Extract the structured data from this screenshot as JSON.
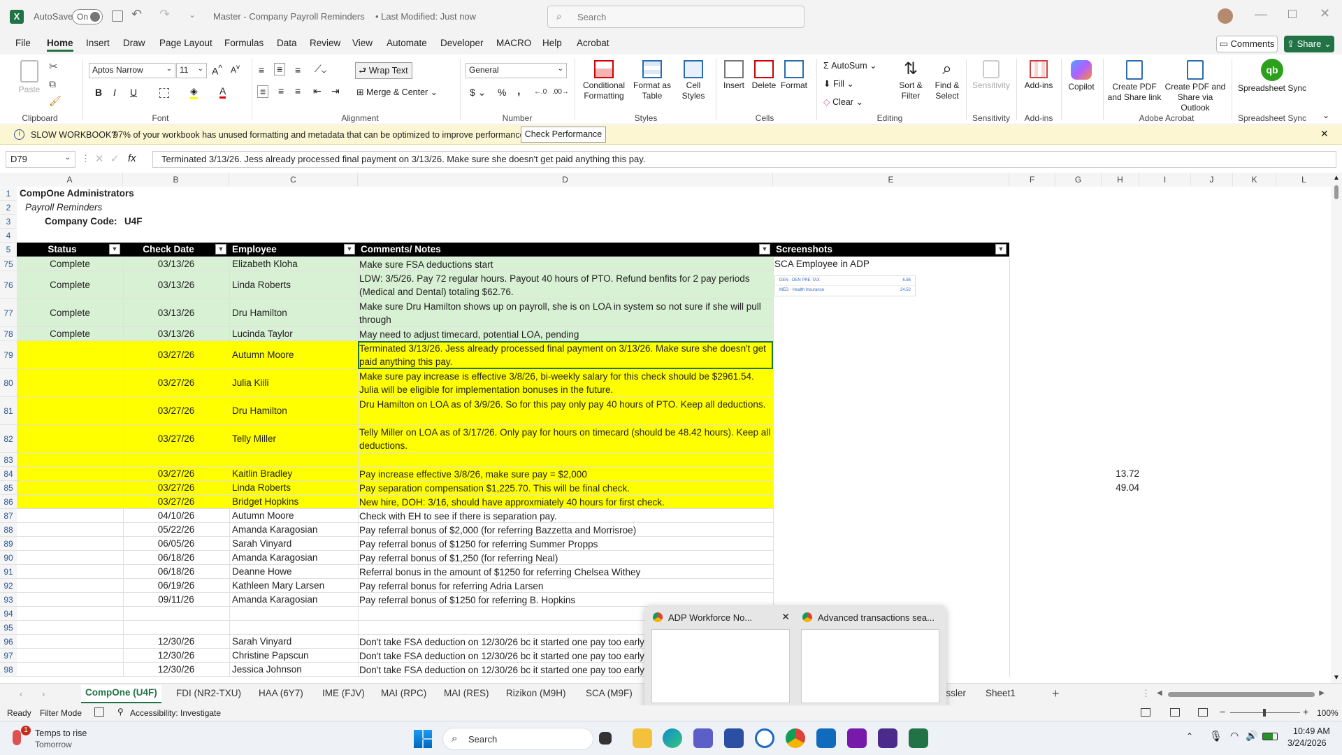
{
  "app": {
    "autosave_label": "AutoSave",
    "autosave_state": "On",
    "title": "Master - Company Payroll Reminders",
    "modified": "• Last Modified: Just now",
    "search_placeholder": "Search"
  },
  "menu": [
    "File",
    "Home",
    "Insert",
    "Draw",
    "Page Layout",
    "Formulas",
    "Data",
    "Review",
    "View",
    "Automate",
    "Developer",
    "MACRO",
    "Help",
    "Acrobat"
  ],
  "menu_active": "Home",
  "comments_label": "Comments",
  "share_label": "Share",
  "ribbon": {
    "clipboard": {
      "paste": "Paste",
      "label": "Clipboard"
    },
    "font": {
      "name": "Aptos Narrow",
      "size": "11",
      "label": "Font"
    },
    "alignment": {
      "wrap": "Wrap Text",
      "merge": "Merge & Center",
      "label": "Alignment"
    },
    "number": {
      "format": "General",
      "label": "Number"
    },
    "styles": {
      "cond": "Conditional Formatting",
      "table": "Format as Table",
      "cell": "Cell Styles",
      "label": "Styles"
    },
    "cells": {
      "insert": "Insert",
      "delete": "Delete",
      "format": "Format",
      "label": "Cells"
    },
    "editing": {
      "autosum": "AutoSum",
      "fill": "Fill",
      "clear": "Clear",
      "sort": "Sort & Filter",
      "find": "Find & Select",
      "label": "Editing"
    },
    "sensitivity": {
      "btn": "Sensitivity",
      "label": "Sensitivity"
    },
    "addins": {
      "btn": "Add-ins",
      "label": "Add-ins"
    },
    "copilot": "Copilot",
    "acrobat": {
      "pdf_link": "Create PDF and Share link",
      "pdf_outlook": "Create PDF and Share via Outlook",
      "label": "Adobe Acrobat"
    },
    "sync": {
      "btn": "Spreadsheet Sync",
      "label": "Spreadsheet Sync"
    }
  },
  "infobar": {
    "title": "SLOW WORKBOOK?",
    "text": "97% of your workbook has unused formatting and metadata that can be optimized to improve performance.",
    "button": "Check Performance"
  },
  "formula": {
    "namebox": "D79",
    "content": "Terminated 3/13/26. Jess already processed final payment on 3/13/26. Make sure she doesn't get paid anything this pay."
  },
  "columns": [
    "A",
    "B",
    "C",
    "D",
    "E",
    "F",
    "G",
    "H",
    "I",
    "J",
    "K",
    "L"
  ],
  "header_rows": {
    "r1": "CompOne Administrators",
    "r2": "Payroll Reminders",
    "r3_label": "Company Code:",
    "r3_value": "U4F"
  },
  "table_headers": [
    "Status",
    "Check Date",
    "Employee",
    "Comments/ Notes",
    "Screenshots"
  ],
  "rows": [
    {
      "num": "75",
      "status": "Complete",
      "date": "03/13/26",
      "emp": "Elizabeth Kloha",
      "note": "Make sure FSA deductions start",
      "shot": "SCA Employee in ADP",
      "fill": "green"
    },
    {
      "num": "76",
      "status": "Complete",
      "date": "03/13/26",
      "emp": "Linda Roberts",
      "note": "LDW: 3/5/26. Pay 72 regular hours. Payout 40 hours of PTO. Refund benfits for 2 pay periods (Medical and Dental) totaling $62.76.",
      "shot": "",
      "fill": "green"
    },
    {
      "num": "77",
      "status": "Complete",
      "date": "03/13/26",
      "emp": "Dru Hamilton",
      "note": "Make sure Dru Hamilton shows up on payroll, she is on LOA in system so not sure if she will pull through",
      "shot": "",
      "fill": "green"
    },
    {
      "num": "78",
      "status": "Complete",
      "date": "03/13/26",
      "emp": "Lucinda Taylor",
      "note": "May need to adjust timecard, potential LOA, pending",
      "shot": "",
      "fill": "green"
    },
    {
      "num": "79",
      "status": "",
      "date": "03/27/26",
      "emp": "Autumn Moore",
      "note": "Terminated 3/13/26. Jess already processed final payment on 3/13/26. Make sure she doesn't get paid anything this pay.",
      "shot": "",
      "fill": "yellow"
    },
    {
      "num": "80",
      "status": "",
      "date": "03/27/26",
      "emp": "Julia Kiili",
      "note": "Make sure pay increase is effective 3/8/26, bi-weekly salary for this check should be $2961.54. Julia will be eligible for implementation bonuses in the future.",
      "shot": "",
      "fill": "yellow"
    },
    {
      "num": "81",
      "status": "",
      "date": "03/27/26",
      "emp": "Dru Hamilton",
      "note": "Dru Hamilton on LOA as of 3/9/26. So for this pay only pay 40 hours of PTO. Keep all deductions.",
      "shot": "",
      "fill": "yellow"
    },
    {
      "num": "82",
      "status": "",
      "date": "03/27/26",
      "emp": "Telly Miller",
      "note": "Telly Miller on LOA as of 3/17/26. Only pay for hours on timecard (should be 48.42 hours). Keep all deductions.",
      "shot": "",
      "fill": "yellow"
    },
    {
      "num": "83",
      "status": "",
      "date": "",
      "emp": "",
      "note": "",
      "shot": "",
      "fill": "yellow"
    },
    {
      "num": "84",
      "status": "",
      "date": "03/27/26",
      "emp": "Kaitlin Bradley",
      "note": "Pay increase effective 3/8/26, make sure pay = $2,000",
      "shot": "",
      "fill": "yellow",
      "h": "13.72"
    },
    {
      "num": "85",
      "status": "",
      "date": "03/27/26",
      "emp": "Linda Roberts",
      "note": "Pay separation compensation $1,225.70. This will be final check.",
      "shot": "",
      "fill": "yellow",
      "h": "49.04"
    },
    {
      "num": "86",
      "status": "",
      "date": "03/27/26",
      "emp": "Bridget Hopkins",
      "note": "New hire, DOH: 3/16, should have approxmiately 40 hours for first check.",
      "shot": "",
      "fill": "yellow"
    },
    {
      "num": "87",
      "status": "",
      "date": "04/10/26",
      "emp": "Autumn Moore",
      "note": "Check with EH to see if there is separation pay.",
      "shot": "",
      "fill": "none"
    },
    {
      "num": "88",
      "status": "",
      "date": "05/22/26",
      "emp": "Amanda Karagosian",
      "note": "Pay referral bonus of $2,000 (for referring Bazzetta and Morrisroe)",
      "shot": "",
      "fill": "none"
    },
    {
      "num": "89",
      "status": "",
      "date": "06/05/26",
      "emp": "Sarah Vinyard",
      "note": "Pay referral bonus of $1250 for referring Summer Propps",
      "shot": "",
      "fill": "none"
    },
    {
      "num": "90",
      "status": "",
      "date": "06/18/26",
      "emp": "Amanda Karagosian",
      "note": "Pay referral bonus of $1,250 (for referring Neal)",
      "shot": "",
      "fill": "none"
    },
    {
      "num": "91",
      "status": "",
      "date": "06/18/26",
      "emp": "Deanne Howe",
      "note": "Referral bonus in the amount of $1250 for referring Chelsea Withey",
      "shot": "",
      "fill": "none"
    },
    {
      "num": "92",
      "status": "",
      "date": "06/19/26",
      "emp": "Kathleen Mary Larsen",
      "note": "Pay referral bonus for referring Adria Larsen",
      "shot": "",
      "fill": "none"
    },
    {
      "num": "93",
      "status": "",
      "date": "09/11/26",
      "emp": "Amanda Karagosian",
      "note": "Pay referral bonus of $1250 for referring B. Hopkins",
      "shot": "",
      "fill": "none"
    },
    {
      "num": "94",
      "status": "",
      "date": "",
      "emp": "",
      "note": "",
      "shot": "",
      "fill": "none"
    },
    {
      "num": "95",
      "status": "",
      "date": "",
      "emp": "",
      "note": "",
      "shot": "",
      "fill": "none"
    },
    {
      "num": "96",
      "status": "",
      "date": "12/30/26",
      "emp": "Sarah Vinyard",
      "note": "Don't take FSA deduction on 12/30/26 bc it started one pay too early",
      "shot": "",
      "fill": "none"
    },
    {
      "num": "97",
      "status": "",
      "date": "12/30/26",
      "emp": "Christine Papscun",
      "note": "Don't take FSA deduction on 12/30/26 bc it started one pay too early",
      "shot": "",
      "fill": "none"
    },
    {
      "num": "98",
      "status": "",
      "date": "12/30/26",
      "emp": "Jessica Johnson",
      "note": "Don't take FSA deduction on 12/30/26 bc it started one pay too early",
      "shot": "",
      "fill": "none"
    }
  ],
  "screenshot_thumb": {
    "line1": "DEN - DEN PRE-TAX",
    "val1": "6.86",
    "line2": "MED - Health Insurance",
    "val2": "24.52"
  },
  "sheet_tabs": [
    "CompOne (U4F)",
    "FDI (NR2-TXU)",
    "HAA (6Y7)",
    "IME (FJV)",
    "MAI (RPC)",
    "MAI (RES)",
    "Rizikon (M9H)",
    "SCA (M9F)",
    "essler",
    "Sheet1"
  ],
  "tab_active": "CompOne (U4F)",
  "popup": {
    "a": "ADP Workforce No...",
    "b": "Advanced transactions sea..."
  },
  "status": {
    "ready": "Ready",
    "filter": "Filter Mode",
    "access": "Accessibility: Investigate",
    "zoom": "100%"
  },
  "taskbar": {
    "weather_title": "Temps to rise",
    "weather_sub": "Tomorrow",
    "badge": "1",
    "search": "Search",
    "time": "10:49 AM",
    "date": "3/24/2026"
  },
  "colors": {
    "green_fill": "#d8f0d3",
    "yellow_fill": "#ffff00",
    "excel": "#217346",
    "header_black": "#000000"
  }
}
